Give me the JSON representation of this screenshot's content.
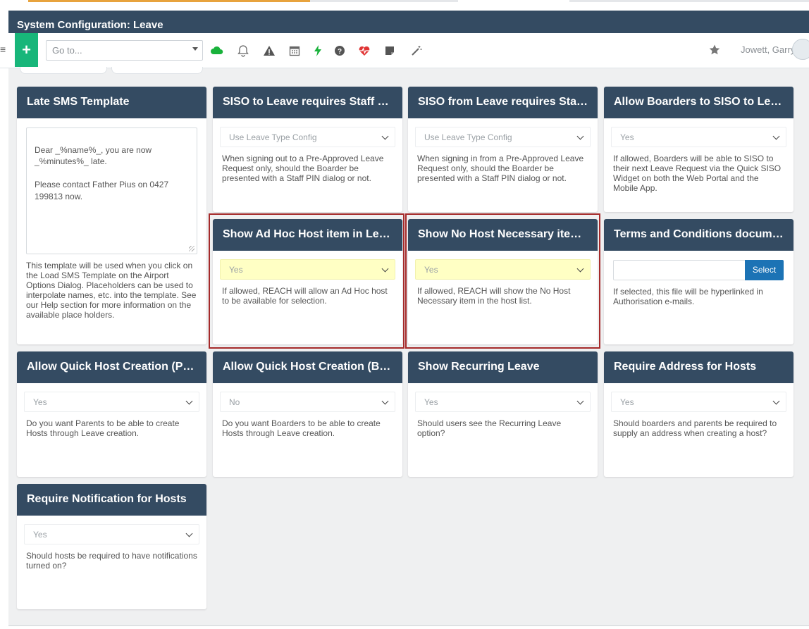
{
  "window": {
    "title": "System Configuration: Leave"
  },
  "toolbar": {
    "add_label": "+",
    "goto_placeholder": "Go to...",
    "user_name": "Jowett, Garry",
    "colors": {
      "title_bar": "#344b62",
      "add_button": "#18b67a",
      "select_button": "#1c73b5",
      "highlight": "#ffffc4",
      "red_outline": "#a52a2a"
    }
  },
  "cards": {
    "late_sms": {
      "title": "Late SMS Template",
      "text": "Dear _%name%_, you are now _%minutes%_ late.\n\nPlease contact Father Pius on 0427 199813 now.",
      "desc": "This template will be used when you click on the Load SMS Template on the Airport Options Dialog. Placeholders can be used to interpolate names, etc. into the template. See our Help section for more information on the available place holders."
    },
    "siso_to": {
      "title": "SISO to Leave requires Staff PIN",
      "value": "Use Leave Type Config",
      "desc": "When signing out to a Pre-Approved Leave Request only, should the Boarder be presented with a Staff PIN dialog or not."
    },
    "siso_from": {
      "title": "SISO from Leave requires Staff ...",
      "value": "Use Leave Type Config",
      "desc": "When signing in from a Pre-Approved Leave Request only, should the Boarder be presented with a Staff PIN dialog or not."
    },
    "allow_boarders_siso": {
      "title": "Allow Boarders to SISO to Leav...",
      "value": "Yes",
      "desc": "If allowed, Boarders will be able to SISO to their next Leave Request via the Quick SISO Widget on both the Web Portal and the Mobile App."
    },
    "ad_hoc_host": {
      "title": "Show Ad Hoc Host item in Leav...",
      "value": "Yes",
      "desc": "If allowed, REACH will allow an Ad Hoc host to be available for selection."
    },
    "no_host": {
      "title": "Show No Host Necessary item i...",
      "value": "Yes",
      "desc": "If allowed, REACH will show the No Host Necessary item in the host list."
    },
    "terms": {
      "title": "Terms and Conditions document",
      "button": "Select",
      "desc": "If selected, this file will be hyperlinked in Authorisation e-mails."
    },
    "quick_host_parents": {
      "title": "Allow Quick Host Creation (Par...",
      "value": "Yes",
      "desc": "Do you want Parents to be able to create Hosts through Leave creation."
    },
    "quick_host_boarders": {
      "title": "Allow Quick Host Creation (Boa...",
      "value": "No",
      "desc": "Do you want Boarders to be able to create Hosts through Leave creation."
    },
    "recurring": {
      "title": "Show Recurring Leave",
      "value": "Yes",
      "desc": "Should users see the Recurring Leave option?"
    },
    "address": {
      "title": "Require Address for Hosts",
      "value": "Yes",
      "desc": "Should boarders and parents be required to supply an address when creating a host?"
    },
    "notification": {
      "title": "Require Notification for Hosts",
      "value": "Yes",
      "desc": "Should hosts be required to have notifications turned on?"
    }
  }
}
